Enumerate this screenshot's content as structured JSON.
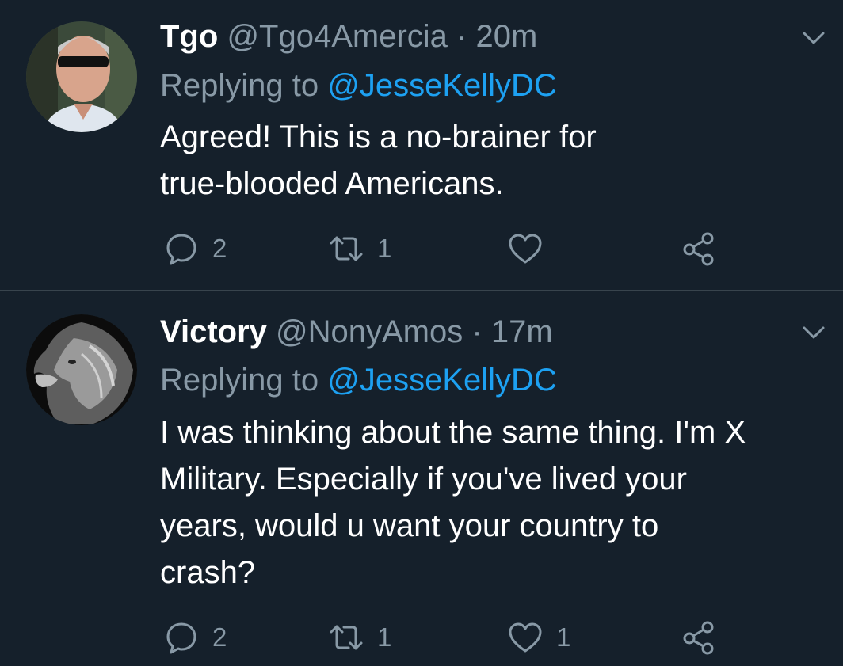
{
  "tweets": [
    {
      "name": "Tgo",
      "handle": "@Tgo4Amercia",
      "separator": "·",
      "time": "20m",
      "replying_label": "Replying to",
      "replying_to": "@JesseKellyDC",
      "text_lines": [
        "Agreed! This is a no-brainer for",
        "true-blooded Americans."
      ],
      "reply_count": "2",
      "retweet_count": "1",
      "like_count": "",
      "avatar": "man-with-sunglasses-photo"
    },
    {
      "name": "Victory",
      "handle": "@NonyAmos",
      "separator": "·",
      "time": "17m",
      "replying_label": "Replying to",
      "replying_to": "@JesseKellyDC",
      "text_lines": [
        "I was thinking about the same thing. I'm X",
        "Military. Especially if you've lived your",
        "years, would u want your country to",
        "crash?"
      ],
      "reply_count": "2",
      "retweet_count": "1",
      "like_count": "1",
      "avatar": "lion-photo"
    }
  ],
  "icons": {
    "reply": "reply-icon",
    "retweet": "retweet-icon",
    "like": "heart-icon",
    "share": "share-icon",
    "menu": "chevron-down-icon"
  },
  "colors": {
    "background": "#15202b",
    "text": "#ffffff",
    "muted": "#8899a6",
    "link": "#1da1f2",
    "divider": "#38444d"
  }
}
